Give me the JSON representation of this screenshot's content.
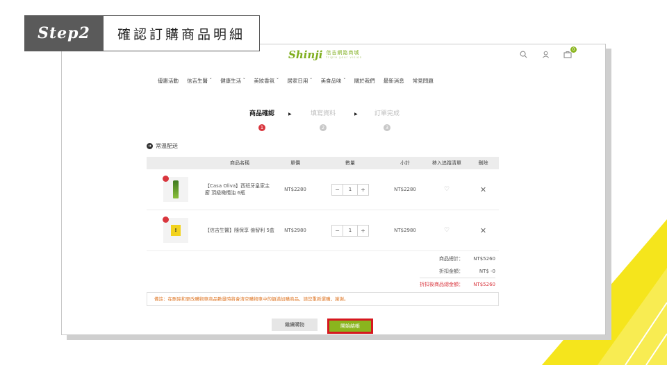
{
  "banner": {
    "step": "Step2",
    "title": "確認訂購商品明細"
  },
  "header": {
    "logo_mark": "Shinji",
    "logo_name": "信吉網路商城",
    "logo_tag": "triple your vision",
    "cart_count": "0"
  },
  "nav": [
    "優惠活動",
    "信吉生醫 ˇ",
    "健康生活 ˇ",
    "美妝香氛 ˇ",
    "居家日用 ˇ",
    "美食品味 ˇ",
    "關於我們",
    "最新消息",
    "常見問題"
  ],
  "steps": [
    {
      "label": "商品確認",
      "num": "1"
    },
    {
      "label": "填寫資料",
      "num": "2"
    },
    {
      "label": "訂單完成",
      "num": "3"
    }
  ],
  "section": {
    "label": "常溫配送"
  },
  "table": {
    "headers": {
      "name": "商品名稱",
      "price": "單價",
      "qty": "數量",
      "subtotal": "小計",
      "fav": "移入追蹤清單",
      "del": "刪除"
    },
    "rows": [
      {
        "name": "【Casa Oliva】西班牙皇家主廚 頂級橄欖油 6瓶",
        "price": "NT$2280",
        "qty": "1",
        "subtotal": "NT$2280"
      },
      {
        "name": "【信吉生醫】隨保享 億智利 5盒",
        "price": "NT$2980",
        "qty": "1",
        "subtotal": "NT$2980"
      }
    ]
  },
  "totals": {
    "goods_label": "商品總計：",
    "goods_value": "NT$5260",
    "discount_label": "折扣金額：",
    "discount_value": "NT$ -0",
    "final_label": "折扣後商品總金額：",
    "final_value": "NT$5260"
  },
  "notice": "備註：在刪除和更改購物車商品數量時將會清空購物車中的額滿加購商品，請您重新選購，謝謝。",
  "buttons": {
    "continue": "繼續購物",
    "checkout": "開始結帳"
  },
  "colors": {
    "accent": "#8ab51e",
    "highlight": "#d6181f",
    "active_step": "#d9363e",
    "deco": "#f5e51c"
  }
}
